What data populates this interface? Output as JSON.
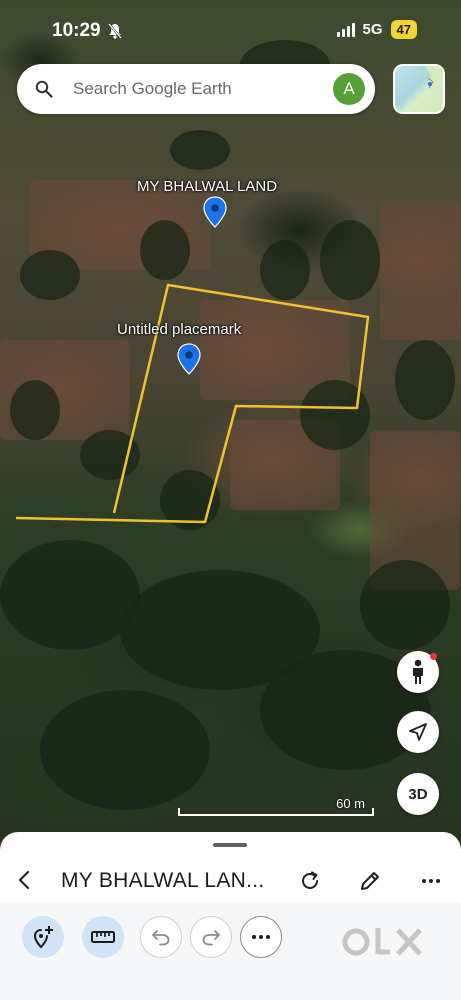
{
  "status_bar": {
    "time": "10:29",
    "network": "5G",
    "battery": "47"
  },
  "search": {
    "placeholder": "Search Google Earth",
    "avatar_letter": "A"
  },
  "map": {
    "placemarks": [
      {
        "label": "MY BHALWAL LAND"
      },
      {
        "label": "Untitled placemark"
      }
    ],
    "scale_label": "60 m",
    "button_3d_label": "3D",
    "boundary_color": "#f2c12e",
    "pin_color": "#1a73e8"
  },
  "sheet": {
    "title": "MY BHALWAL LAN..."
  },
  "toolbar": {
    "tools": [
      "add-placemark-icon",
      "ruler-icon",
      "undo-icon",
      "redo-icon",
      "more-icon"
    ]
  },
  "watermark": "OLX"
}
